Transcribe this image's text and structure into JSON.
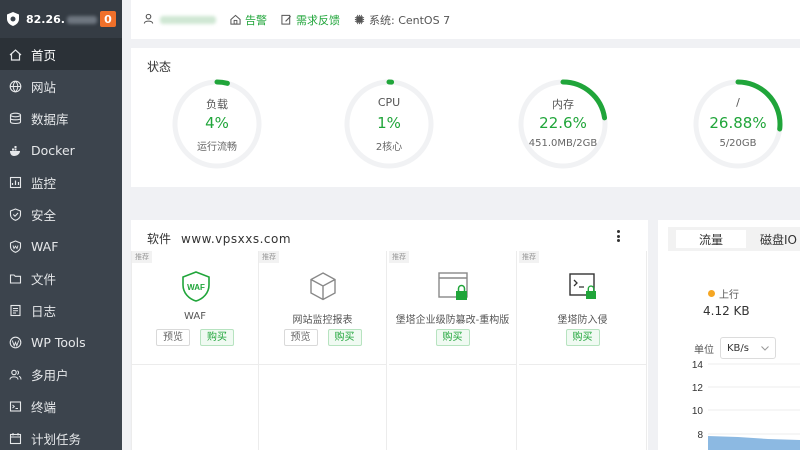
{
  "sidebar": {
    "ip": "82.26.",
    "badge": "0",
    "items": [
      {
        "label": "首页",
        "icon": "home-icon"
      },
      {
        "label": "网站",
        "icon": "globe-icon"
      },
      {
        "label": "数据库",
        "icon": "database-icon"
      },
      {
        "label": "Docker",
        "icon": "docker-icon"
      },
      {
        "label": "监控",
        "icon": "monitor-icon"
      },
      {
        "label": "安全",
        "icon": "shield-icon"
      },
      {
        "label": "WAF",
        "icon": "waf-shield-icon"
      },
      {
        "label": "文件",
        "icon": "folder-icon"
      },
      {
        "label": "日志",
        "icon": "log-icon"
      },
      {
        "label": "WP Tools",
        "icon": "wordpress-icon"
      },
      {
        "label": "多用户",
        "icon": "users-icon"
      },
      {
        "label": "终端",
        "icon": "terminal-icon"
      },
      {
        "label": "计划任务",
        "icon": "calendar-icon"
      }
    ]
  },
  "topbar": {
    "alert": "告警",
    "feedback": "需求反馈",
    "system": "系统: CentOS 7"
  },
  "status": {
    "title": "状态",
    "gauges": [
      {
        "label": "负载",
        "value": "4%",
        "percent": 0.04,
        "sub": "运行流畅"
      },
      {
        "label": "CPU",
        "value": "1%",
        "percent": 0.01,
        "sub": "2核心"
      },
      {
        "label": "内存",
        "value": "22.6%",
        "percent": 0.226,
        "sub": "451.0MB/2GB"
      },
      {
        "label": "/",
        "value": "26.88%",
        "percent": 0.2688,
        "sub": "5/20GB"
      }
    ]
  },
  "software": {
    "title": "软件",
    "site": "www.vpsxxs.com",
    "tag": "推荐",
    "preview": "预览",
    "buy": "购买",
    "cards": [
      {
        "name": "WAF",
        "icon": "waf-icon",
        "has_preview": true
      },
      {
        "name": "网站监控报表",
        "icon": "cube-icon",
        "has_preview": true
      },
      {
        "name": "堡塔企业级防篡改-重构版",
        "icon": "window-lock-icon",
        "has_preview": false
      },
      {
        "name": "堡塔防入侵",
        "icon": "terminal-lock-icon",
        "has_preview": false
      }
    ]
  },
  "traffic": {
    "tabs": [
      "流量",
      "磁盘IO"
    ],
    "up_label": "上行",
    "up_value": "4.12 KB",
    "unit_label": "单位",
    "unit_value": "KB/s",
    "y_ticks": [
      "14",
      "12",
      "10",
      "8"
    ],
    "colors": {
      "area": "#5b9bd5",
      "up_dot": "#f5a623"
    }
  },
  "colors": {
    "accent": "#20a53a",
    "sidebar": "#3c444d",
    "badge": "#f0702a"
  }
}
